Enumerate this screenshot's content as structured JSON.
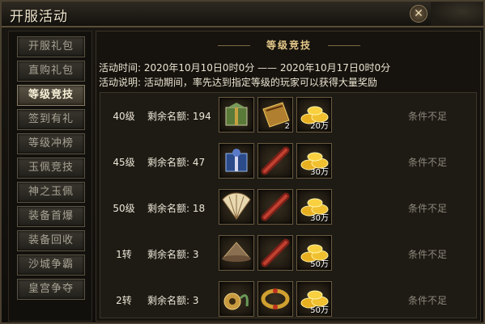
{
  "window": {
    "title": "开服活动",
    "close_label": "✕"
  },
  "sidebar": {
    "items": [
      {
        "label": "开服礼包",
        "active": false
      },
      {
        "label": "直购礼包",
        "active": false
      },
      {
        "label": "等级竞技",
        "active": true
      },
      {
        "label": "签到有礼",
        "active": false
      },
      {
        "label": "等级冲榜",
        "active": false
      },
      {
        "label": "玉佩竞技",
        "active": false
      },
      {
        "label": "神之玉佩",
        "active": false
      },
      {
        "label": "装备首爆",
        "active": false
      },
      {
        "label": "装备回收",
        "active": false
      },
      {
        "label": "沙城争霸",
        "active": false
      },
      {
        "label": "皇宫争夺",
        "active": false
      }
    ]
  },
  "panel": {
    "header_title": "等级竞技",
    "time_line": "活动时间: 2020年10月10日0时0分  ——  2020年10月17日0时0分",
    "desc_line": "活动说明: 活动期间，率先达到指定等级的玩家可以获得大量奖励",
    "rows": [
      {
        "level": "40级",
        "quota": "剩余名额: 194",
        "status": "条件不足",
        "items": [
          {
            "icon": "gift-box-icon",
            "count": ""
          },
          {
            "icon": "golden-scroll-icon",
            "count": "2"
          },
          {
            "icon": "gold-ingot-icon",
            "count": "20万"
          }
        ]
      },
      {
        "level": "45级",
        "quota": "剩余名额: 47",
        "status": "条件不足",
        "items": [
          {
            "icon": "blue-gift-box-icon",
            "count": ""
          },
          {
            "icon": "red-scroll-icon",
            "count": ""
          },
          {
            "icon": "gold-ingot-icon",
            "count": "30万"
          }
        ]
      },
      {
        "level": "50级",
        "quota": "剩余名额: 18",
        "status": "条件不足",
        "items": [
          {
            "icon": "folding-fan-icon",
            "count": ""
          },
          {
            "icon": "red-scroll-icon",
            "count": ""
          },
          {
            "icon": "gold-ingot-icon",
            "count": "30万"
          }
        ]
      },
      {
        "level": "1转",
        "quota": "剩余名额: 3",
        "status": "条件不足",
        "items": [
          {
            "icon": "straw-hat-icon",
            "count": ""
          },
          {
            "icon": "red-scroll-icon",
            "count": ""
          },
          {
            "icon": "gold-ingot-icon",
            "count": "50万"
          }
        ]
      },
      {
        "level": "2转",
        "quota": "剩余名额: 3",
        "status": "条件不足",
        "items": [
          {
            "icon": "jade-pendant-icon",
            "count": ""
          },
          {
            "icon": "bracelet-icon",
            "count": ""
          },
          {
            "icon": "gold-ingot-icon",
            "count": "50万"
          }
        ]
      }
    ]
  }
}
